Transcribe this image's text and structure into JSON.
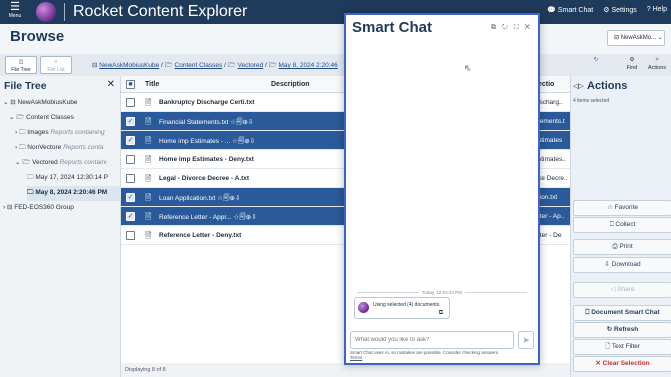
{
  "header": {
    "menu_icon": "☰",
    "menu_label": "Menu",
    "brand": "Rocket Content Explorer",
    "smart_chat": "Smart Chat",
    "settings": "Settings",
    "help": "Help"
  },
  "browse": {
    "title": "Browse",
    "repo_select": "NewAskMo..."
  },
  "toolbar": {
    "file_tree": "File Tree",
    "file_list": "File List",
    "refresh_label": "Find",
    "actions_label": "Actions"
  },
  "breadcrumb": [
    "NewAskMobiusKube",
    "Content Classes",
    "Vectored",
    "May 8, 2024 2:20:46"
  ],
  "file_tree": {
    "title": "File Tree",
    "close": "✕",
    "nodes": [
      "NewAskMobiusKube",
      "Content Classes",
      "Images",
      "Reports containing",
      "NonVectore",
      "Reports conta",
      "Vectored",
      "Reports containi",
      "May 17, 2024 12:30:14 P",
      "May 8, 2024 2:20:46 PM",
      "FED-EOS360 Group"
    ]
  },
  "table": {
    "col_title": "Title",
    "col_desc": "Description",
    "col_last": "ectio",
    "rows": [
      {
        "name": "Bankruptcy Discharge Certi.txt",
        "last": "ischarg..",
        "sel": false
      },
      {
        "name": "Financial Statements.txt  ☆🗐⊕⇩",
        "last": "tements.t",
        "sel": true
      },
      {
        "name": "Home imp Estimates - ...   ☆🗐⊕⇩",
        "last": "stimates",
        "sel": true
      },
      {
        "name": "Home imp Estimates - Deny.txt",
        "last": "stimates..",
        "sel": false
      },
      {
        "name": "Legal - Divorce Decree - A.txt",
        "last": "ce Decre..",
        "sel": false
      },
      {
        "name": "Loan Application.txt  ☆🗐⊕⇩",
        "last": "tion.txt",
        "sel": true
      },
      {
        "name": "Reference Letter - Appr...  ☆🗐⊕⇩",
        "last": "tter - Ap..",
        "sel": true
      },
      {
        "name": "Reference Letter - Deny.txt",
        "last": "tter - De",
        "sel": false
      }
    ],
    "footer": "Displaying 8 of 8"
  },
  "chat": {
    "title": "Smart Chat",
    "icons": "⧉ ↻ ⛶ ✕",
    "today": "Today, 12:53:44 PM",
    "message": "Using selected (4) documents.",
    "copy": "⧉",
    "placeholder": "What would you like to ask?",
    "send": "➤",
    "disclaimer": "Smart Chat uses AI, so mistakes are possible. Consider checking answers.",
    "terms": "Terms"
  },
  "actions": {
    "title": "Actions",
    "subtitle": "4 items selected",
    "buttons": [
      "☆ Favorite",
      "⎕ Collect",
      "⎙ Print",
      "⇩ Download",
      "◁ Share",
      "⎕ Document Smart Chat",
      "↻ Refresh",
      "🗋 Text Filter",
      "✕ Clear Selection"
    ]
  }
}
